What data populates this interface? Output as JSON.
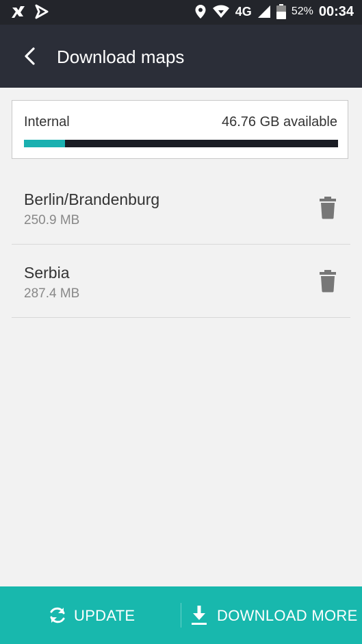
{
  "status_bar": {
    "network": "4G",
    "battery_percent": "52%",
    "time": "00:34",
    "icons": [
      "tool-icon",
      "navigation-icon",
      "location-icon",
      "wifi-icon",
      "signal-icon",
      "battery-icon"
    ]
  },
  "header": {
    "title": "Download maps",
    "back_icon": "chevron-left-icon"
  },
  "storage": {
    "name": "Internal",
    "available": "46.76 GB available",
    "used_fraction": 0.13,
    "fill_color": "#1ab0b0",
    "track_color": "#1a1c24"
  },
  "maps": [
    {
      "name": "Berlin/Brandenburg",
      "size": "250.9 MB",
      "action_icon": "trash-icon"
    },
    {
      "name": "Serbia",
      "size": "287.4 MB",
      "action_icon": "trash-icon"
    }
  ],
  "bottom_bar": {
    "background_color": "#18b8ad",
    "update_label": "UPDATE",
    "update_icon": "refresh-icon",
    "download_more_label": "DOWNLOAD MORE",
    "download_icon": "download-icon"
  }
}
